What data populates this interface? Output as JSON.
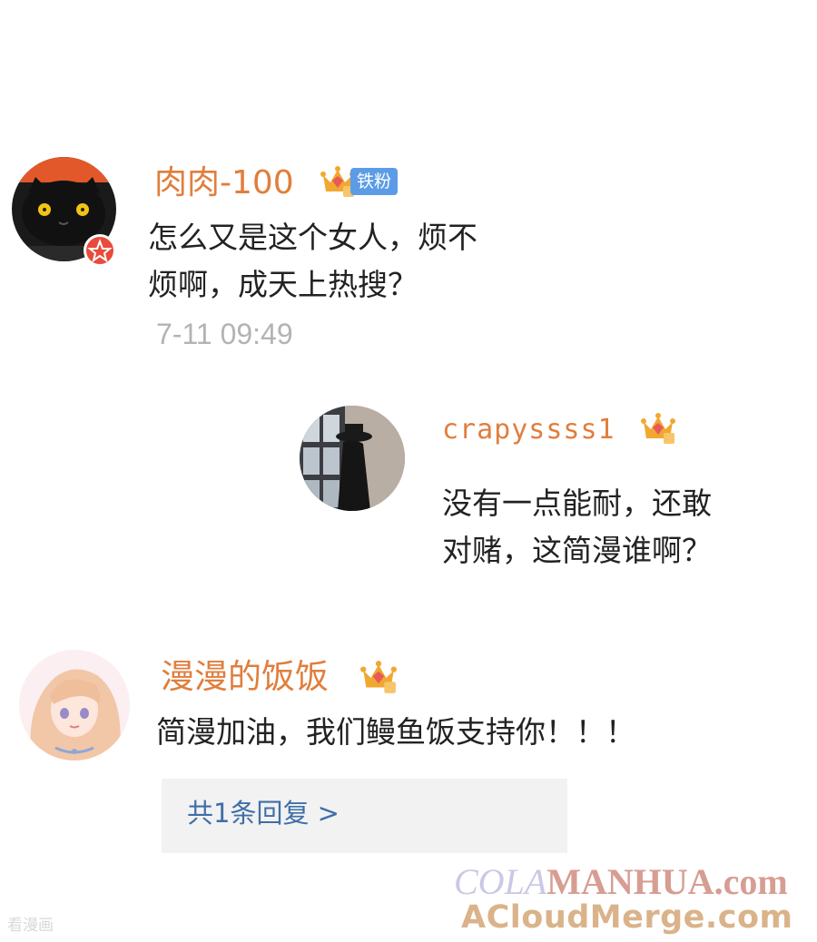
{
  "comments": [
    {
      "username": "肉肉-100",
      "fan_badge": "铁粉",
      "content_lines": [
        "怎么又是这个女人，烦不",
        "烦啊，成天上热搜？"
      ],
      "time": "7-11 09:49",
      "avatar_icon": "black-cat-avatar"
    }
  ],
  "reply": {
    "username": "crapyssss1",
    "content_lines": [
      "没有一点能耐，还敢",
      "对赌，这简漫谁啊？"
    ],
    "avatar_icon": "woman-window-avatar"
  },
  "comment2": {
    "username": "漫漫的饭饭",
    "content": "简漫加油，我们鳗鱼饭支持你！！！",
    "avatar_icon": "anime-girl-avatar",
    "replies_link": "共1条回复 >"
  },
  "watermark": {
    "line1a": "COLA",
    "line1b": "MANHUA.com",
    "line2": "ACloudMerge.com",
    "corner": "看漫画"
  },
  "colors": {
    "username": "#e07e3d",
    "badge_blue": "#5c9ce6",
    "crown_gold": "#f0a830",
    "link": "#3f6fa7"
  }
}
